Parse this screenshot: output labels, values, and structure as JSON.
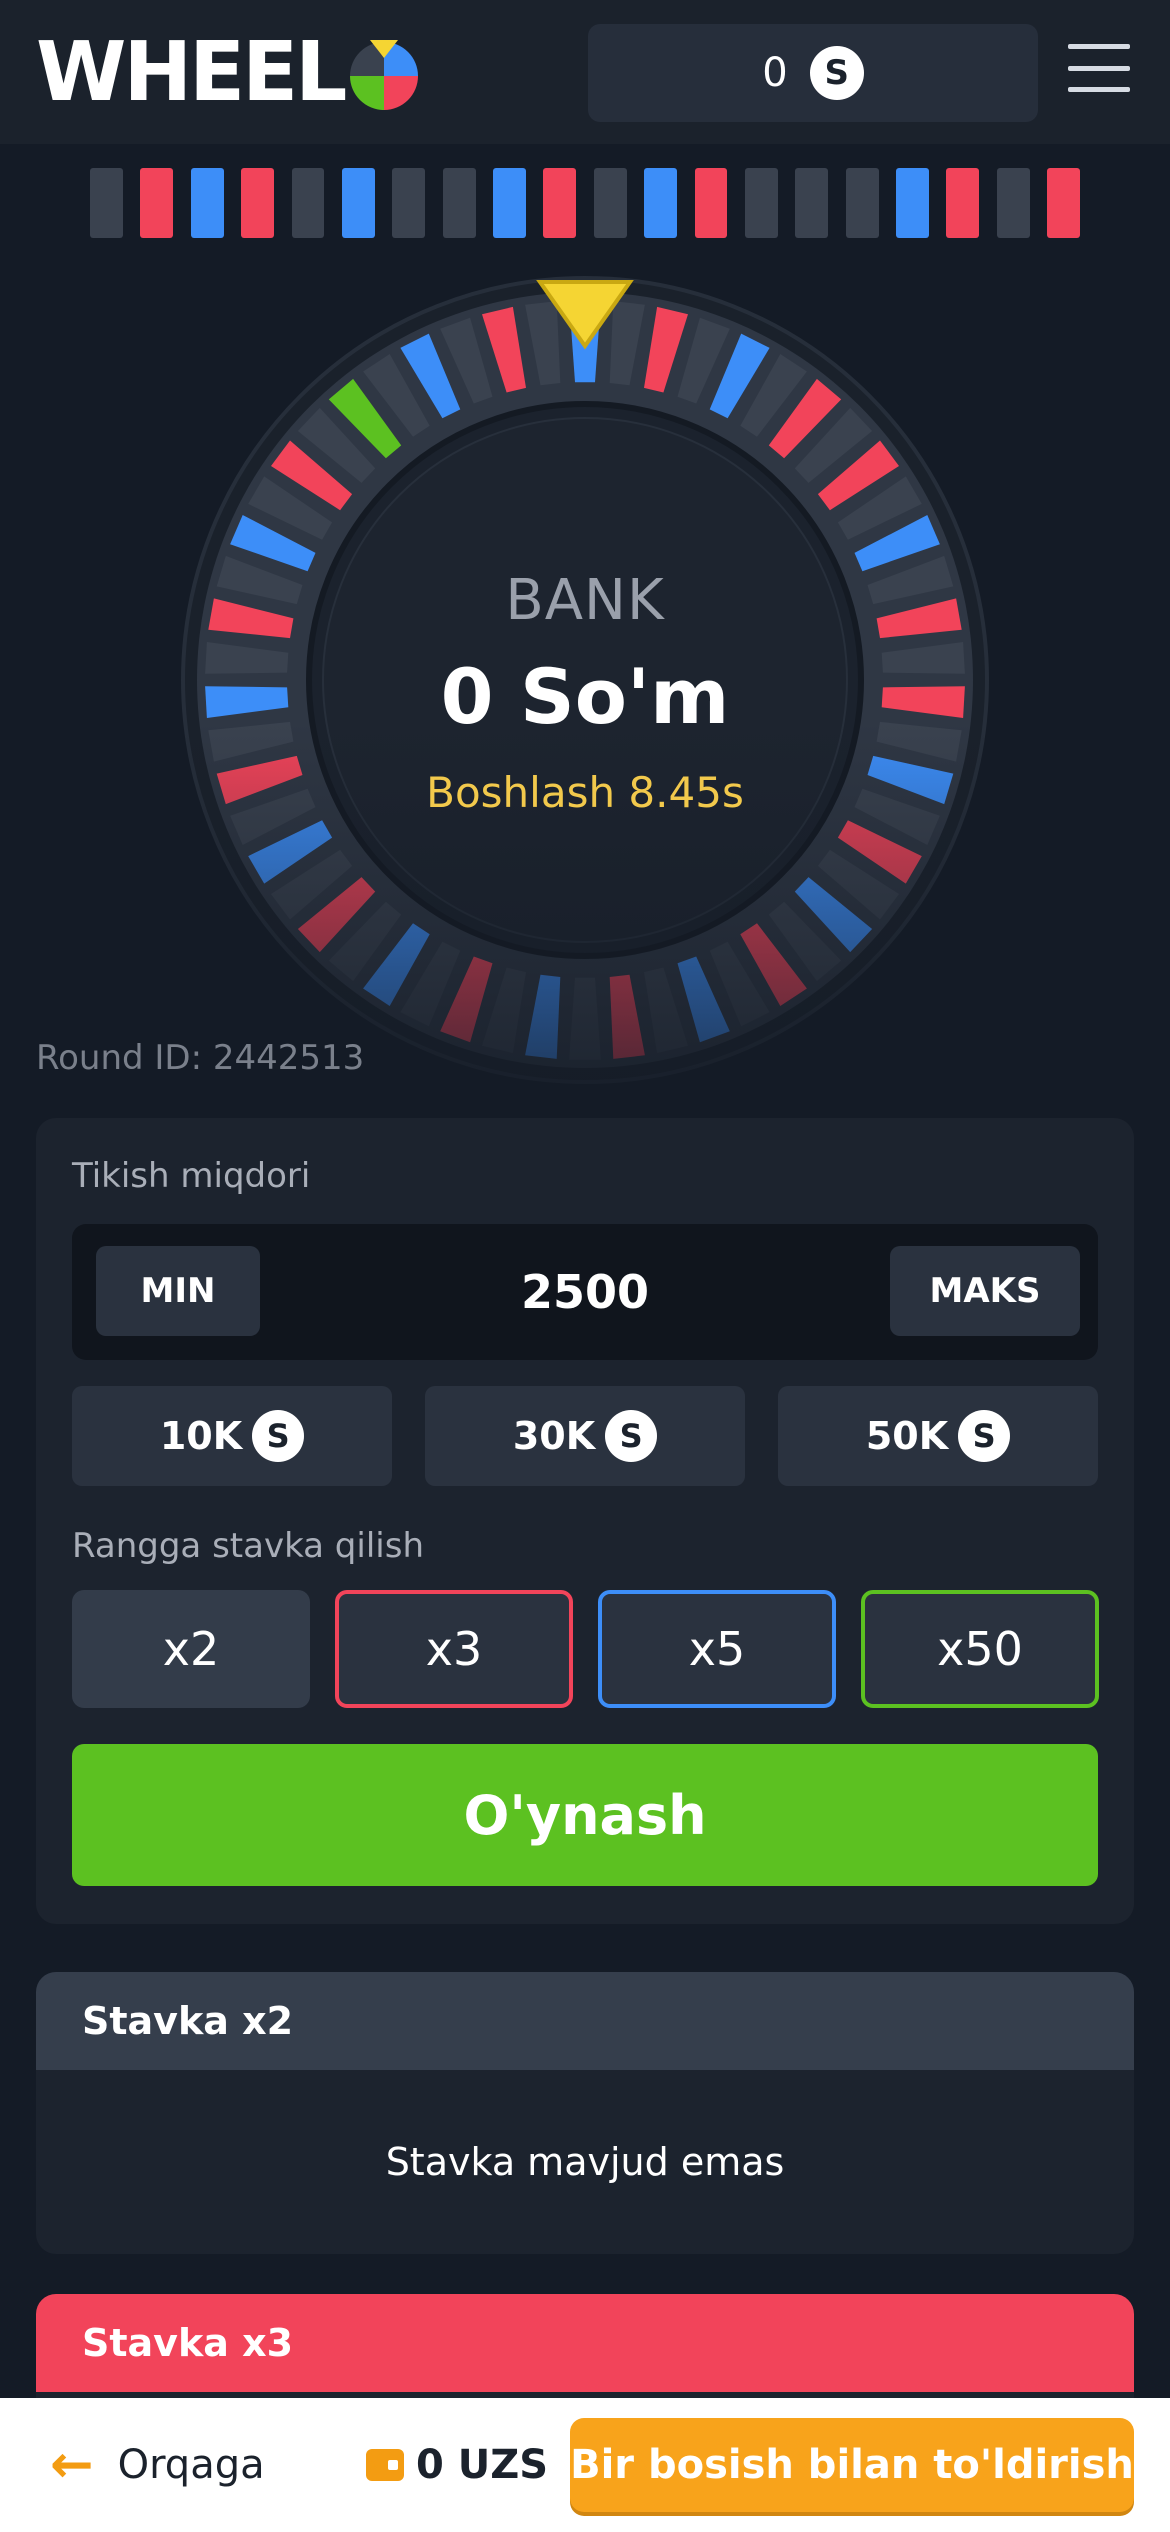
{
  "header": {
    "logo_text": "WHEEL",
    "balance": "0",
    "coin_icon": "S"
  },
  "history": [
    "dark",
    "red",
    "blue",
    "red",
    "dark",
    "blue",
    "dark",
    "dark",
    "blue",
    "red",
    "dark",
    "blue",
    "red",
    "dark",
    "dark",
    "dark",
    "blue",
    "red",
    "dark",
    "red"
  ],
  "colors": {
    "dark": "#3a424f",
    "red": "#f2445a",
    "blue": "#3d8ef8",
    "green": "#5cc121",
    "pointer": "#f5d533",
    "accent": "#f8a31b"
  },
  "wheel": {
    "bank_label": "BANK",
    "bank_value": "0 So'm",
    "timer": "Boshlash 8.45s"
  },
  "round": {
    "label": "Round ID: 2442513"
  },
  "bet": {
    "amount_label": "Tikish miqdori",
    "min_label": "MIN",
    "amount": "2500",
    "max_label": "MAKS",
    "quick": [
      {
        "label": "10K"
      },
      {
        "label": "30K"
      },
      {
        "label": "50K"
      }
    ],
    "color_label": "Rangga stavka qilish",
    "multipliers": [
      {
        "label": "x2"
      },
      {
        "label": "x3"
      },
      {
        "label": "x5"
      },
      {
        "label": "x50"
      }
    ],
    "play_label": "O'ynash"
  },
  "stakes": [
    {
      "title": "Stavka x2",
      "empty_text": "Stavka mavjud emas"
    },
    {
      "title": "Stavka x3"
    }
  ],
  "bottom": {
    "back_label": "Orqaga",
    "balance": "0 UZS",
    "topup_label": "Bir bosish bilan to'ldirish"
  }
}
